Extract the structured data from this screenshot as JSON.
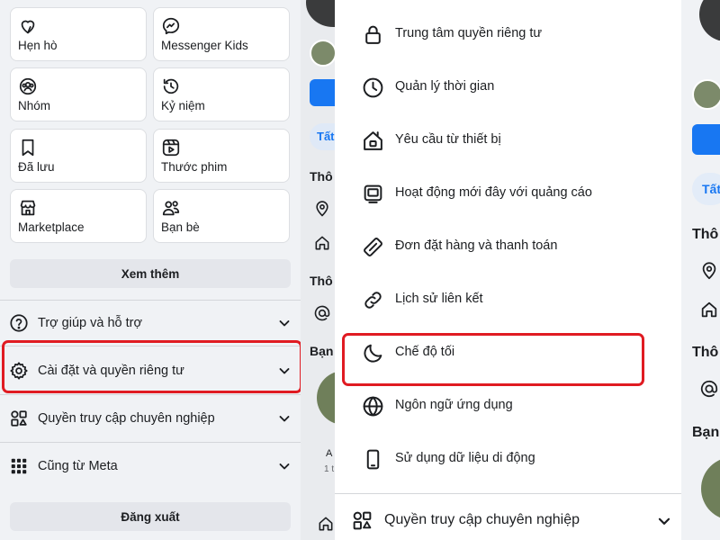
{
  "shortcuts": [
    {
      "label": "Hẹn hò",
      "icon": "heart-icon"
    },
    {
      "label": "Messenger Kids",
      "icon": "messenger-icon"
    },
    {
      "label": "Nhóm",
      "icon": "groups-icon"
    },
    {
      "label": "Kỷ niệm",
      "icon": "memories-icon"
    },
    {
      "label": "Đã lưu",
      "icon": "bookmark-icon"
    },
    {
      "label": "Thước phim",
      "icon": "reels-icon"
    },
    {
      "label": "Marketplace",
      "icon": "marketplace-icon"
    },
    {
      "label": "Bạn bè",
      "icon": "friends-icon"
    }
  ],
  "see_more_label": "Xem thêm",
  "left_menu": [
    {
      "label": "Trợ giúp và hỗ trợ",
      "icon": "help-icon"
    },
    {
      "label": "Cài đặt và quyền riêng tư",
      "icon": "gear-icon"
    },
    {
      "label": "Quyền truy cập chuyên nghiệp",
      "icon": "professional-icon"
    },
    {
      "label": "Cũng từ Meta",
      "icon": "grid-icon"
    }
  ],
  "logout_label": "Đăng xuất",
  "settings_menu": [
    {
      "label": "Trung tâm quyền riêng tư",
      "icon": "lock-icon"
    },
    {
      "label": "Quản lý thời gian",
      "icon": "clock-icon"
    },
    {
      "label": "Yêu cầu từ thiết bị",
      "icon": "device-request-icon"
    },
    {
      "label": "Hoạt động mới đây với quảng cáo",
      "icon": "ad-activity-icon"
    },
    {
      "label": "Đơn đặt hàng và thanh toán",
      "icon": "payment-card-icon"
    },
    {
      "label": "Lịch sử liên kết",
      "icon": "link-icon"
    },
    {
      "label": "Chế độ tối",
      "icon": "moon-icon"
    },
    {
      "label": "Ngôn ngữ ứng dụng",
      "icon": "globe-icon"
    },
    {
      "label": "Sử dụng dữ liệu di động",
      "icon": "phone-icon"
    }
  ],
  "sheet_bottom_label": "Quyền truy cập chuyên nghiệp",
  "bg_mid": {
    "tab": "Tất",
    "section1": "Thô",
    "section2": "Thô",
    "section3": "Bạn",
    "small1": "A",
    "small2": "1 t"
  },
  "bg_right": {
    "tab": "Tất",
    "section1": "Thô",
    "section2": "Thô",
    "section3": "Bạn"
  },
  "colors": {
    "highlight": "#e01b22",
    "fb_blue": "#1877f2",
    "panel_bg": "#f0f2f5"
  }
}
